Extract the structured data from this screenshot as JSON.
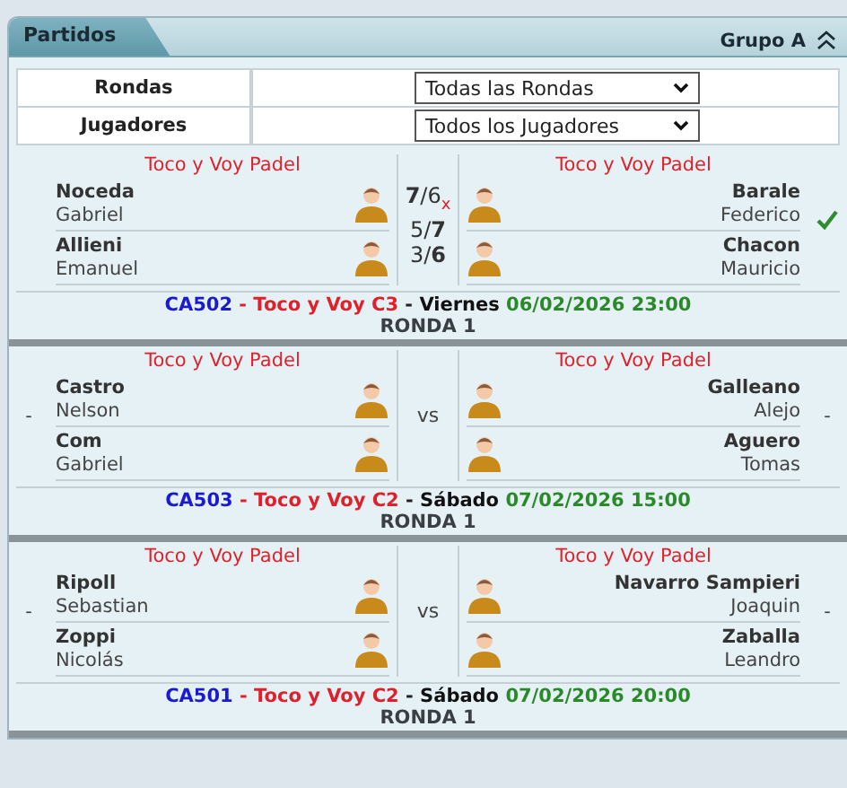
{
  "panel": {
    "title": "Partidos",
    "group": "Grupo A",
    "expanded": true
  },
  "filters": [
    {
      "label": "Rondas",
      "value": "Todas las Rondas"
    },
    {
      "label": "Jugadores",
      "value": "Todos los Jugadores"
    }
  ],
  "matches": [
    {
      "teams": [
        {
          "club": "Toco y Voy Padel",
          "winner": false,
          "players": [
            {
              "last": "Noceda",
              "first": "Gabriel"
            },
            {
              "last": "Allieni",
              "first": "Emanuel"
            }
          ]
        },
        {
          "club": "Toco y Voy Padel",
          "winner": true,
          "players": [
            {
              "last": "Barale",
              "first": "Federico"
            },
            {
              "last": "Chacon",
              "first": "Mauricio"
            }
          ]
        }
      ],
      "sets": [
        {
          "score": "**7**/6",
          "note": "x"
        },
        {
          "score": "5/**7**"
        },
        {
          "score": "3/**6**"
        }
      ],
      "code": "CA502",
      "category": "Toco y Voy C3",
      "day": "Viernes",
      "date": "06/02/2026 23:00",
      "round": "RONDA 1"
    },
    {
      "teams": [
        {
          "club": "Toco y Voy Padel",
          "winner": false,
          "marker": "-",
          "players": [
            {
              "last": "Castro",
              "first": "Nelson"
            },
            {
              "last": "Com",
              "first": "Gabriel"
            }
          ]
        },
        {
          "club": "Toco y Voy Padel",
          "winner": false,
          "marker": "-",
          "players": [
            {
              "last": "Galleano",
              "first": "Alejo"
            },
            {
              "last": "Aguero",
              "first": "Tomas"
            }
          ]
        }
      ],
      "versus": "vs",
      "code": "CA503",
      "category": "Toco y Voy C2",
      "day": "Sábado",
      "date": "07/02/2026 15:00",
      "round": "RONDA 1"
    },
    {
      "teams": [
        {
          "club": "Toco y Voy Padel",
          "winner": false,
          "marker": "-",
          "players": [
            {
              "last": "Ripoll",
              "first": "Sebastian"
            },
            {
              "last": "Zoppi",
              "first": "Nicolás"
            }
          ]
        },
        {
          "club": "Toco y Voy Padel",
          "winner": false,
          "marker": "-",
          "players": [
            {
              "last": "Navarro Sampieri",
              "first": "Joaquin"
            },
            {
              "last": "Zaballa",
              "first": "Leandro"
            }
          ]
        }
      ],
      "versus": "vs",
      "code": "CA501",
      "category": "Toco y Voy C2",
      "day": "Sábado",
      "date": "07/02/2026 20:00",
      "round": "RONDA 1"
    }
  ]
}
